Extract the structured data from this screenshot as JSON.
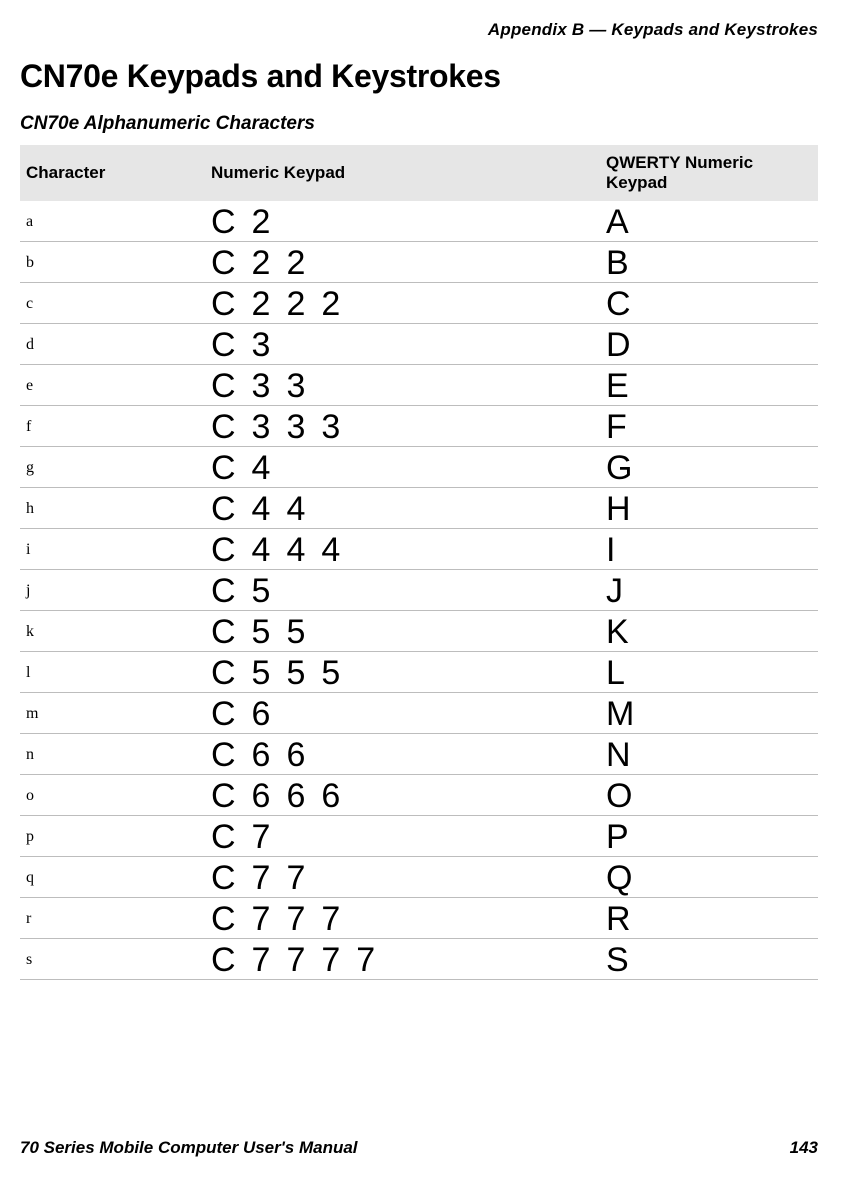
{
  "running_head": "Appendix B — Keypads and Keystrokes",
  "section_title": "CN70e Keypads and Keystrokes",
  "subsection_title": "CN70e Alphanumeric Characters",
  "columns": {
    "c1": "Character",
    "c2": "Numeric Keypad",
    "c3": "QWERTY Numeric Keypad"
  },
  "rows": [
    {
      "char": "a",
      "numeric": [
        "C",
        "2"
      ],
      "qwerty": [
        "A"
      ]
    },
    {
      "char": "b",
      "numeric": [
        "C",
        "2",
        "2"
      ],
      "qwerty": [
        "B"
      ]
    },
    {
      "char": "c",
      "numeric": [
        "C",
        "2",
        "2",
        "2"
      ],
      "qwerty": [
        "C"
      ]
    },
    {
      "char": "d",
      "numeric": [
        "C",
        "3"
      ],
      "qwerty": [
        "D"
      ]
    },
    {
      "char": "e",
      "numeric": [
        "C",
        "3",
        "3"
      ],
      "qwerty": [
        "E"
      ]
    },
    {
      "char": "f",
      "numeric": [
        "C",
        "3",
        "3",
        "3"
      ],
      "qwerty": [
        "F"
      ]
    },
    {
      "char": "g",
      "numeric": [
        "C",
        "4"
      ],
      "qwerty": [
        "G"
      ]
    },
    {
      "char": "h",
      "numeric": [
        "C",
        "4",
        "4"
      ],
      "qwerty": [
        "H"
      ]
    },
    {
      "char": "i",
      "numeric": [
        "C",
        "4",
        "4",
        "4"
      ],
      "qwerty": [
        "I"
      ]
    },
    {
      "char": "j",
      "numeric": [
        "C",
        "5"
      ],
      "qwerty": [
        "J"
      ]
    },
    {
      "char": "k",
      "numeric": [
        "C",
        "5",
        "5"
      ],
      "qwerty": [
        "K"
      ]
    },
    {
      "char": "l",
      "numeric": [
        "C",
        "5",
        "5",
        "5"
      ],
      "qwerty": [
        "L"
      ]
    },
    {
      "char": "m",
      "numeric": [
        "C",
        "6"
      ],
      "qwerty": [
        "M"
      ]
    },
    {
      "char": "n",
      "numeric": [
        "C",
        "6",
        "6"
      ],
      "qwerty": [
        "N"
      ]
    },
    {
      "char": "o",
      "numeric": [
        "C",
        "6",
        "6",
        "6"
      ],
      "qwerty": [
        "O"
      ]
    },
    {
      "char": "p",
      "numeric": [
        "C",
        "7"
      ],
      "qwerty": [
        "P"
      ]
    },
    {
      "char": "q",
      "numeric": [
        "C",
        "7",
        "7"
      ],
      "qwerty": [
        "Q"
      ]
    },
    {
      "char": "r",
      "numeric": [
        "C",
        "7",
        "7",
        "7"
      ],
      "qwerty": [
        "R"
      ]
    },
    {
      "char": "s",
      "numeric": [
        "C",
        "7",
        "7",
        "7",
        "7"
      ],
      "qwerty": [
        "S"
      ]
    }
  ],
  "footer": {
    "left": "70 Series Mobile Computer User's Manual",
    "right": "143"
  }
}
